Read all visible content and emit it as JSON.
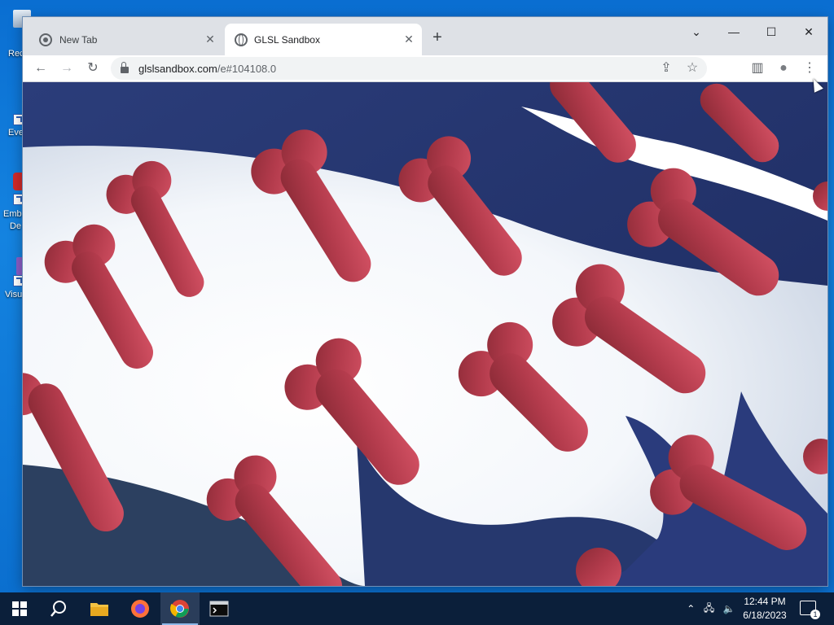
{
  "desktop": {
    "icons": [
      {
        "label": "Rec",
        "icon": "recycle-bin-icon"
      },
      {
        "label": "Eve",
        "icon": "shortcut-icon"
      },
      {
        "label": "Emb",
        "icon": "app-icon"
      },
      {
        "label": "De",
        "icon": "app-icon"
      },
      {
        "label": "Visu",
        "icon": "visual-studio-icon"
      }
    ]
  },
  "browser": {
    "tabs": [
      {
        "title": "New Tab",
        "active": false,
        "close": "✕"
      },
      {
        "title": "GLSL Sandbox",
        "active": true,
        "close": "✕"
      }
    ],
    "new_tab_symbol": "+",
    "window_controls": {
      "dropdown": "⌄",
      "minimize": "—",
      "maximize": "☐",
      "close": "✕"
    },
    "toolbar": {
      "back": "←",
      "forward": "→",
      "reload": "↻"
    },
    "address": {
      "host": "glslsandbox.com",
      "path": "/e#104108.0"
    },
    "toolbar_right": {
      "share": "⇪",
      "bookmark": "☆",
      "side_panel": "▥",
      "profile": "●",
      "menu": "⋮"
    }
  },
  "taskbar": {
    "apps": [
      {
        "name": "start",
        "icon": "windows-start-icon"
      },
      {
        "name": "search",
        "icon": "search-icon"
      },
      {
        "name": "file-explorer",
        "icon": "folder-icon"
      },
      {
        "name": "firefox",
        "icon": "firefox-icon"
      },
      {
        "name": "chrome",
        "icon": "chrome-icon",
        "active": true
      },
      {
        "name": "terminal",
        "icon": "terminal-icon"
      }
    ],
    "clock": {
      "time": "12:44 PM",
      "date": "6/18/2023"
    },
    "notifications_count": "1"
  },
  "colors": {
    "shape_red": "#c94a5a",
    "shape_dark_red": "#8a2a36",
    "canvas_navy": "#1f2f66",
    "canvas_white": "#ffffff",
    "taskbar": "#0b1f3a"
  }
}
